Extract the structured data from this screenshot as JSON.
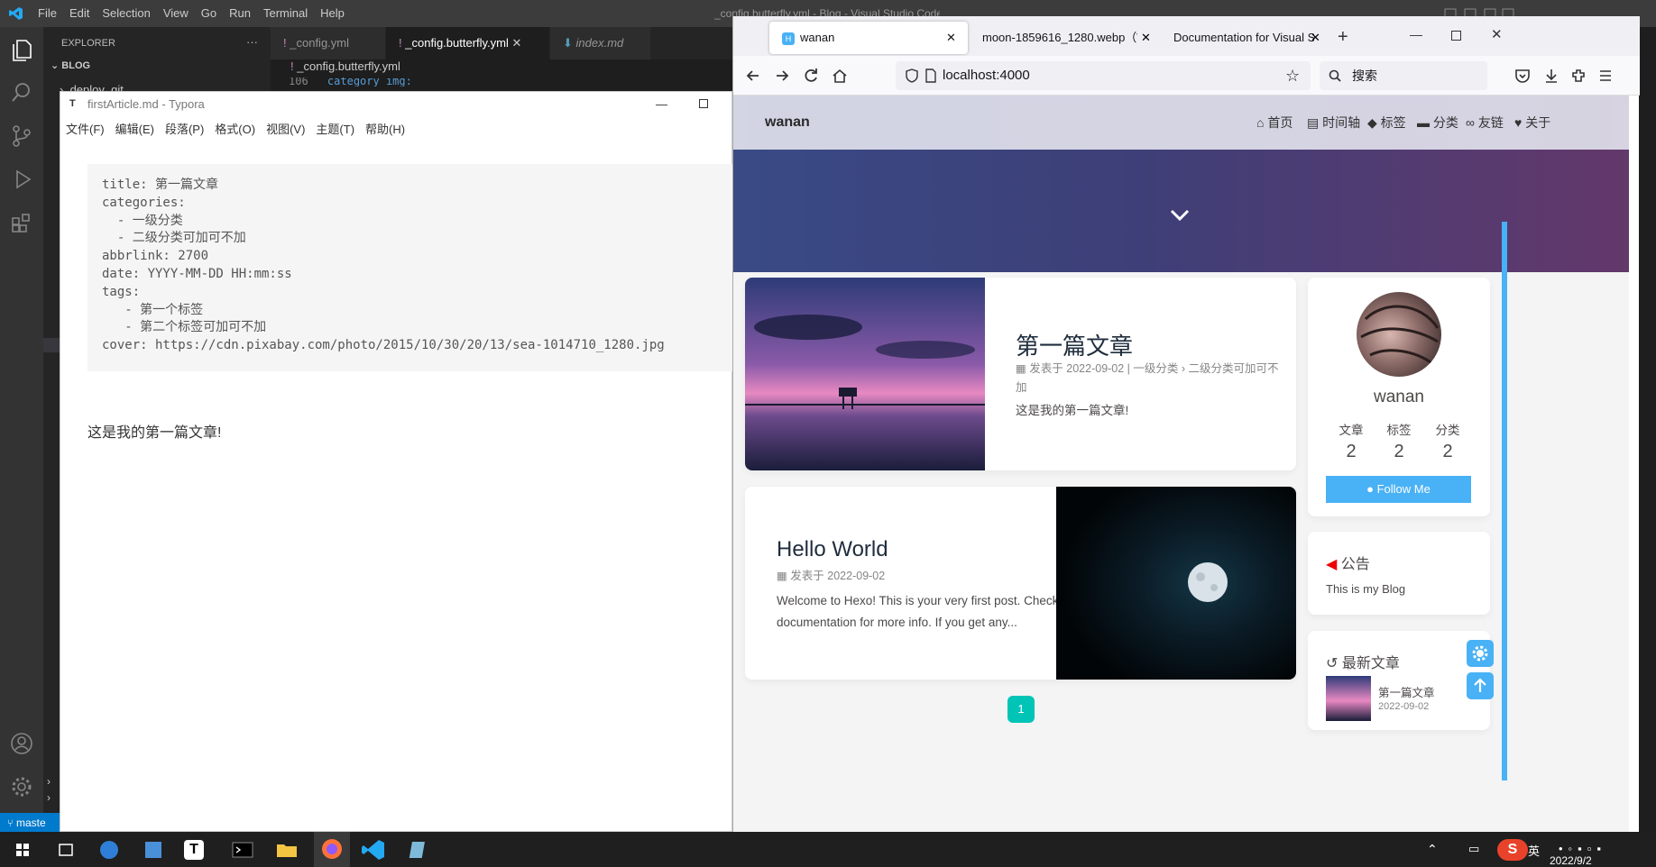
{
  "vscode": {
    "window_title": "_config.butterfly.yml - Blog - Visual Studio Code",
    "menu": [
      "File",
      "Edit",
      "Selection",
      "View",
      "Go",
      "Run",
      "Terminal",
      "Help"
    ],
    "explorer_label": "EXPLORER",
    "explorer_more": "···",
    "folder": "BLOG",
    "tree_item": ".deploy_git",
    "tabs": [
      "_config.yml",
      "_config.butterfly.yml",
      "index.md"
    ],
    "breadcrumb": "_config.butterfly.yml",
    "line_number": "106",
    "code_line": "category_img:",
    "branch": "maste",
    "accent": "#007acc"
  },
  "typora": {
    "title": "firstArticle.md - Typora",
    "menu": [
      "文件(F)",
      "编辑(E)",
      "段落(P)",
      "格式(O)",
      "视图(V)",
      "主题(T)",
      "帮助(H)"
    ],
    "front_matter": "title: 第一篇文章\ncategories:\n  - 一级分类\n  - 二级分类可加可不加\nabbrlink: 2700\ndate: YYYY-MM-DD HH:mm:ss\ntags:\n   - 第一个标签\n   - 第二个标签可加可不加\ncover: https://cdn.pixabay.com/photo/2015/10/30/20/13/sea-1014710_1280.jpg",
    "body": "这是我的第一篇文章!"
  },
  "firefox": {
    "tabs": [
      "wanan",
      "moon-1859616_1280.webp（WE",
      "Documentation for Visual Stu"
    ],
    "new_tab": "+",
    "url": "localhost:4000",
    "search_placeholder": "搜索"
  },
  "blog": {
    "site_name": "wanan",
    "nav": [
      "首页",
      "时间轴",
      "标签",
      "分类",
      "友链",
      "关于"
    ],
    "posts": [
      {
        "title": "第一篇文章",
        "meta_1": "发表于 2022-09-02 | 一级分类 › 二级分类可加可不",
        "meta_2": "加",
        "excerpt": "这是我的第一篇文章!"
      },
      {
        "title": "Hello World",
        "meta_1": "发表于 2022-09-02",
        "excerpt_1": "Welcome to Hexo! This is your very first post. Check",
        "excerpt_2": "documentation for more info. If you get any..."
      }
    ],
    "author": {
      "name": "wanan",
      "stats": [
        {
          "label": "文章",
          "value": "2"
        },
        {
          "label": "标签",
          "value": "2"
        },
        {
          "label": "分类",
          "value": "2"
        }
      ],
      "follow": "Follow Me"
    },
    "announcement": {
      "title": "公告",
      "text": "This is my Blog"
    },
    "recent": {
      "title": "最新文章",
      "items": [
        {
          "title": "第一篇文章",
          "date": "2022-09-02"
        }
      ]
    },
    "page_number": "1",
    "accent": "#49b1f5",
    "pager_color": "#00c4b6"
  },
  "taskbar": {
    "ime": "英",
    "date": "2022/9/2",
    "ime2": "英"
  }
}
